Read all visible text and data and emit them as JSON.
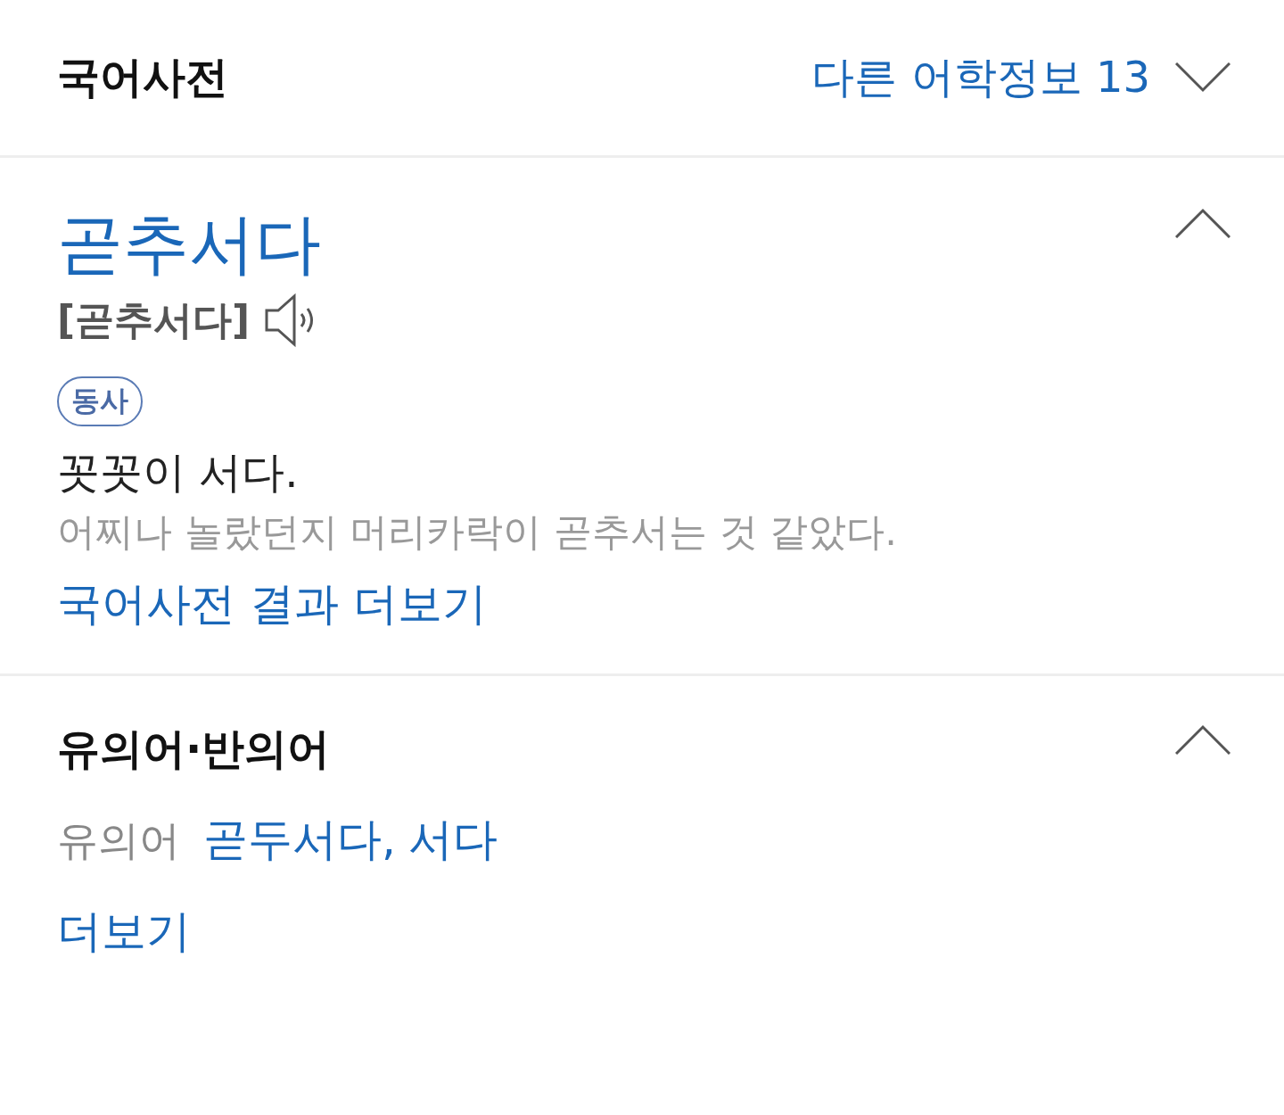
{
  "header": {
    "title": "국어사전",
    "other_info": {
      "label": "다른 어학정보 13",
      "expanded": false
    }
  },
  "entry": {
    "expanded": true,
    "headword": "곧추서다",
    "pronunciation": "[곧추서다]",
    "part_of_speech": "동사",
    "definition": "꼿꼿이 서다.",
    "example": "어찌나 놀랐던지 머리카락이 곧추서는 것 같았다.",
    "more_link": "국어사전 결과 더보기"
  },
  "synonyms": {
    "title": "유의어·반의어",
    "expanded": true,
    "rows": [
      {
        "label": "유의어",
        "words": [
          "곧두서다,",
          "서다"
        ]
      }
    ],
    "more_link": "더보기"
  }
}
